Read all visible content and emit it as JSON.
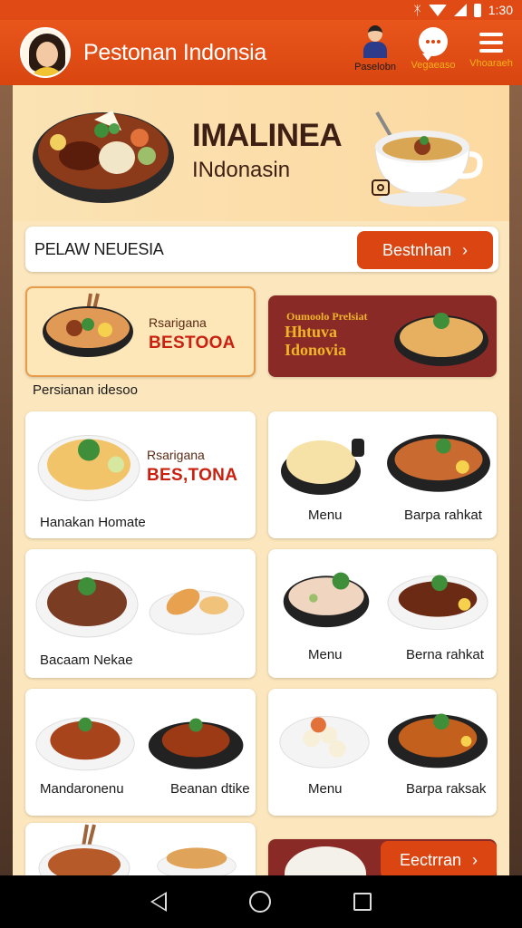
{
  "status_bar": {
    "time": "1:30",
    "icons": [
      "bluetooth-icon",
      "wifi-icon",
      "signal-icon",
      "battery-icon"
    ]
  },
  "header": {
    "title": "Pestonan Indonsia",
    "actions": [
      {
        "label": "Paselobn",
        "icon": "person-icon"
      },
      {
        "label": "Vegaeaso",
        "icon": "chat-icon"
      },
      {
        "label": "Vhoaraeh",
        "icon": "menu-icon"
      }
    ]
  },
  "hero": {
    "title": "IMALINEA",
    "subtitle": "INdonasin",
    "badge_icon": "camera-icon"
  },
  "promo_bar": {
    "text": "PELAW NEUESIA",
    "button_label": "Bestnhan",
    "button_icon": "chevron-right-icon"
  },
  "cards": {
    "featured": {
      "small": "Rsarigana",
      "big": "BESTOOA",
      "caption": "Persianan idesoo"
    },
    "brown": {
      "line1": "Oumoolo Prelsiat",
      "line2": "Hhtuva",
      "line3": "Idonovia"
    },
    "card2": {
      "small": "Rsarigana",
      "big": "BES,TONA",
      "label": "Hanakan Homate"
    },
    "card3": {
      "label1": "Menu",
      "label2": "Barpa rahkat"
    },
    "card4": {
      "label": "Bacaam Nekae"
    },
    "card5": {
      "label1": "Menu",
      "label2": "Berna rahkat"
    },
    "card6": {
      "label1": "Mandaronenu",
      "label2": "Beanan dtike"
    },
    "card7": {
      "label1": "Menu",
      "label2": "Barpa raksak"
    },
    "card9": {
      "button_label": "Eectrran",
      "button_icon": "chevron-right-icon"
    }
  },
  "colors": {
    "accent": "#da4512",
    "header": "#e04a14",
    "panel": "#fbe6bd",
    "brand_red": "#c9200f",
    "brown_card": "#8a2a26",
    "gold": "#f0b429"
  },
  "nav": {
    "icons": [
      "back-icon",
      "home-icon",
      "recents-icon"
    ]
  }
}
